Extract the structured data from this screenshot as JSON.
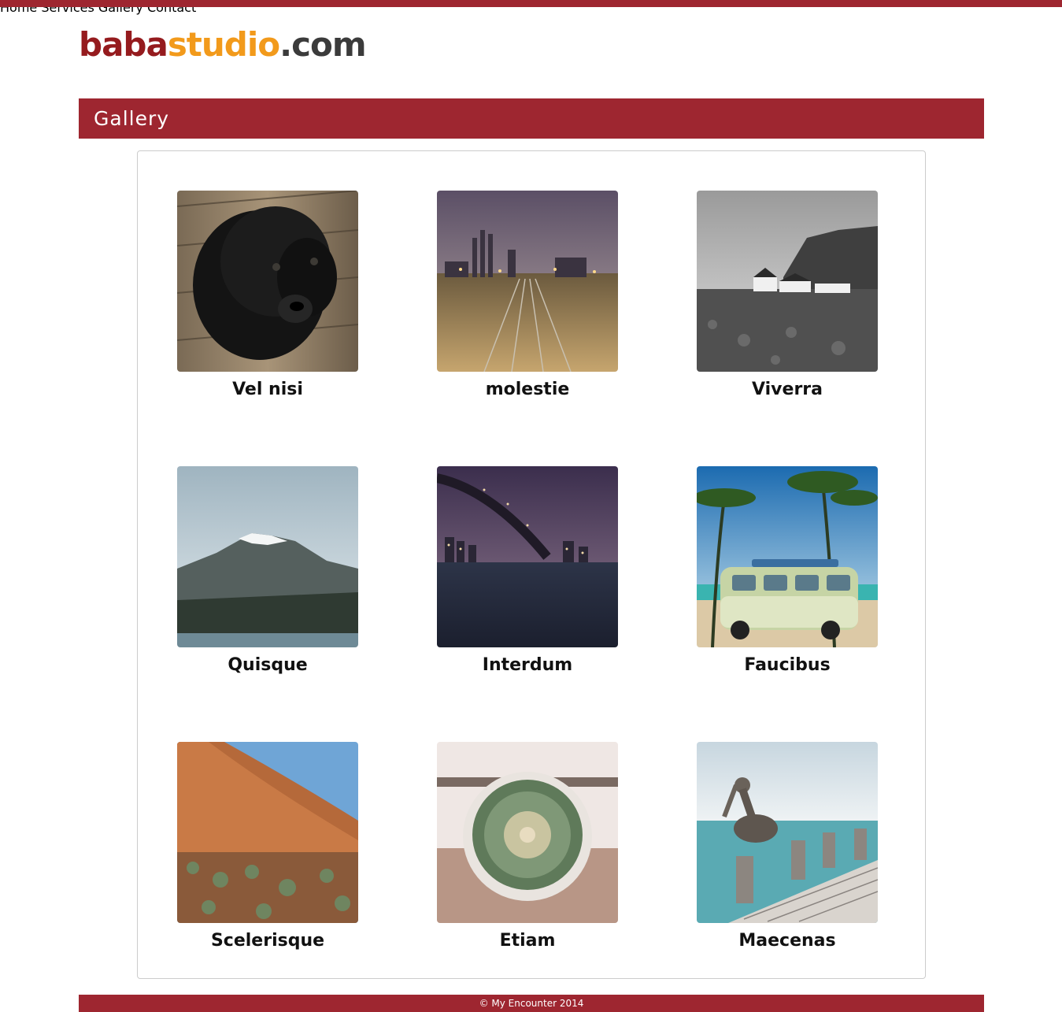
{
  "logo": {
    "part1": "baba",
    "part2": "studio",
    "part3": ".com"
  },
  "nav": [
    {
      "label": "Home"
    },
    {
      "label": "Services"
    },
    {
      "label": "Gallery"
    },
    {
      "label": "Contact"
    }
  ],
  "page_title": "Gallery",
  "gallery": [
    {
      "caption": "Vel nisi",
      "image": "black-puppy-photo"
    },
    {
      "caption": "molestie",
      "image": "railway-tracks-night-photo"
    },
    {
      "caption": "Viverra",
      "image": "coastal-cliff-village-photo"
    },
    {
      "caption": "Quisque",
      "image": "snowy-mountain-photo"
    },
    {
      "caption": "Interdum",
      "image": "bridge-city-night-photo"
    },
    {
      "caption": "Faucibus",
      "image": "vw-bus-palm-beach-photo"
    },
    {
      "caption": "Scelerisque",
      "image": "red-rock-desert-photo"
    },
    {
      "caption": "Etiam",
      "image": "cactus-pot-photo"
    },
    {
      "caption": "Maecenas",
      "image": "pelican-pier-photo"
    }
  ],
  "footer": {
    "copyright": "© My Encounter 2014"
  },
  "colors": {
    "brand_red": "#9e2630",
    "logo_orange": "#f29a1b",
    "logo_dark": "#3b3b3b"
  }
}
